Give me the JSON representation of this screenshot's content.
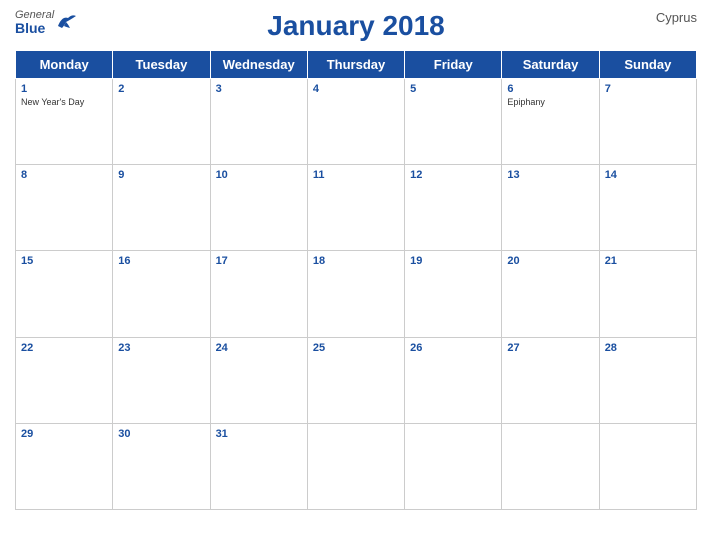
{
  "header": {
    "title": "January 2018",
    "country": "Cyprus",
    "logo": {
      "general": "General",
      "blue": "Blue"
    }
  },
  "weekdays": [
    "Monday",
    "Tuesday",
    "Wednesday",
    "Thursday",
    "Friday",
    "Saturday",
    "Sunday"
  ],
  "weeks": [
    [
      {
        "day": "1",
        "holiday": "New Year's Day"
      },
      {
        "day": "2",
        "holiday": ""
      },
      {
        "day": "3",
        "holiday": ""
      },
      {
        "day": "4",
        "holiday": ""
      },
      {
        "day": "5",
        "holiday": ""
      },
      {
        "day": "6",
        "holiday": "Epiphany"
      },
      {
        "day": "7",
        "holiday": ""
      }
    ],
    [
      {
        "day": "8",
        "holiday": ""
      },
      {
        "day": "9",
        "holiday": ""
      },
      {
        "day": "10",
        "holiday": ""
      },
      {
        "day": "11",
        "holiday": ""
      },
      {
        "day": "12",
        "holiday": ""
      },
      {
        "day": "13",
        "holiday": ""
      },
      {
        "day": "14",
        "holiday": ""
      }
    ],
    [
      {
        "day": "15",
        "holiday": ""
      },
      {
        "day": "16",
        "holiday": ""
      },
      {
        "day": "17",
        "holiday": ""
      },
      {
        "day": "18",
        "holiday": ""
      },
      {
        "day": "19",
        "holiday": ""
      },
      {
        "day": "20",
        "holiday": ""
      },
      {
        "day": "21",
        "holiday": ""
      }
    ],
    [
      {
        "day": "22",
        "holiday": ""
      },
      {
        "day": "23",
        "holiday": ""
      },
      {
        "day": "24",
        "holiday": ""
      },
      {
        "day": "25",
        "holiday": ""
      },
      {
        "day": "26",
        "holiday": ""
      },
      {
        "day": "27",
        "holiday": ""
      },
      {
        "day": "28",
        "holiday": ""
      }
    ],
    [
      {
        "day": "29",
        "holiday": ""
      },
      {
        "day": "30",
        "holiday": ""
      },
      {
        "day": "31",
        "holiday": ""
      },
      {
        "day": "",
        "holiday": ""
      },
      {
        "day": "",
        "holiday": ""
      },
      {
        "day": "",
        "holiday": ""
      },
      {
        "day": "",
        "holiday": ""
      }
    ]
  ],
  "colors": {
    "header_bg": "#1a4fa0",
    "header_text": "#ffffff",
    "day_number": "#1a4fa0",
    "title": "#1a4fa0"
  }
}
